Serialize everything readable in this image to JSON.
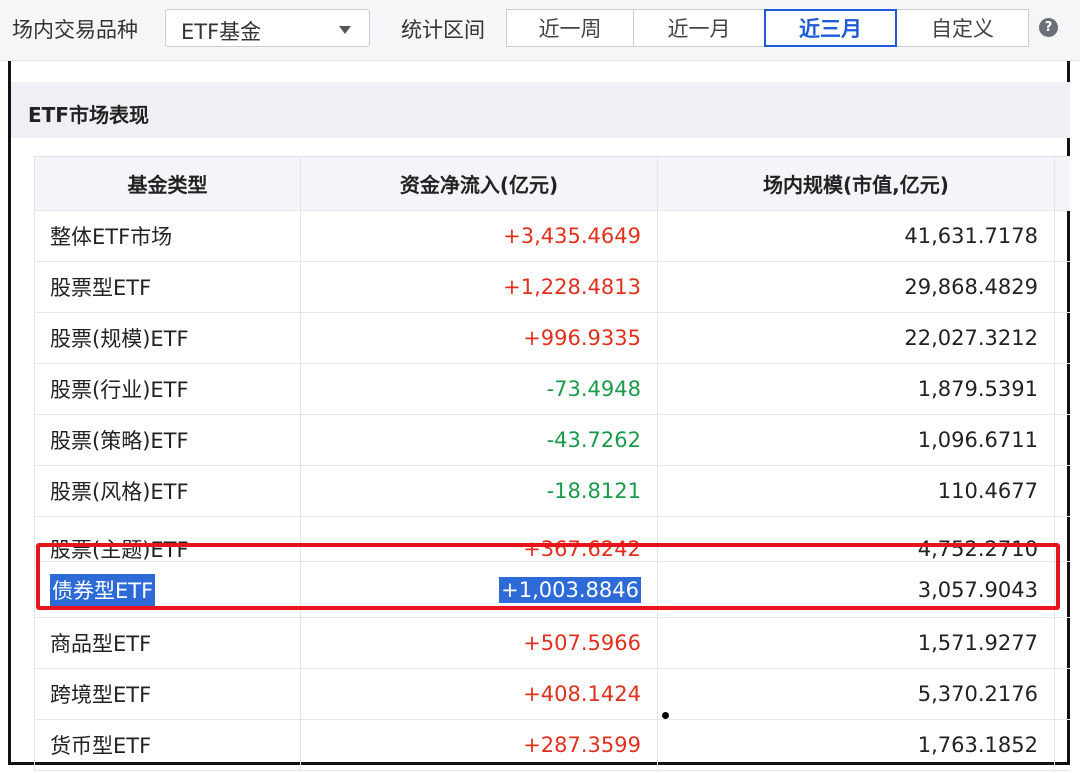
{
  "filter": {
    "variety_label": "场内交易品种",
    "variety_value": "ETF基金",
    "period_label": "统计区间",
    "tabs": [
      "近一周",
      "近一月",
      "近三月",
      "自定义"
    ],
    "active_tab": "近三月",
    "help_symbol": "?"
  },
  "section": {
    "title": "ETF市场表现"
  },
  "table": {
    "headers": [
      "基金类型",
      "资金净流入(亿元)",
      "场内规模(市值,亿元)"
    ],
    "rows": [
      {
        "type": "整体ETF市场",
        "inflow": "+3,435.4649",
        "scale": "41,631.7178"
      },
      {
        "type": "股票型ETF",
        "inflow": "+1,228.4813",
        "scale": "29,868.4829"
      },
      {
        "type": "股票(规模)ETF",
        "inflow": "+996.9335",
        "scale": "22,027.3212"
      },
      {
        "type": "股票(行业)ETF",
        "inflow": "-73.4948",
        "scale": "1,879.5391"
      },
      {
        "type": "股票(策略)ETF",
        "inflow": "-43.7262",
        "scale": "1,096.6711"
      },
      {
        "type": "股票(风格)ETF",
        "inflow": "-18.8121",
        "scale": "110.4677"
      },
      {
        "type": "股票(主题)ETF",
        "inflow": "+367.6242",
        "scale": "4,752.2710"
      },
      {
        "type": "债券型ETF",
        "inflow": "+1,003.8846",
        "scale": "3,057.9043"
      },
      {
        "type": "商品型ETF",
        "inflow": "+507.5966",
        "scale": "1,571.9277"
      },
      {
        "type": "跨境型ETF",
        "inflow": "+408.1424",
        "scale": "5,370.2176"
      },
      {
        "type": "货币型ETF",
        "inflow": "+287.3599",
        "scale": "1,763.1852"
      }
    ]
  },
  "colors": {
    "positive": "#e0301e",
    "negative": "#1a9a4a",
    "accent": "#1e5bd6",
    "highlight": "#e8141c"
  }
}
